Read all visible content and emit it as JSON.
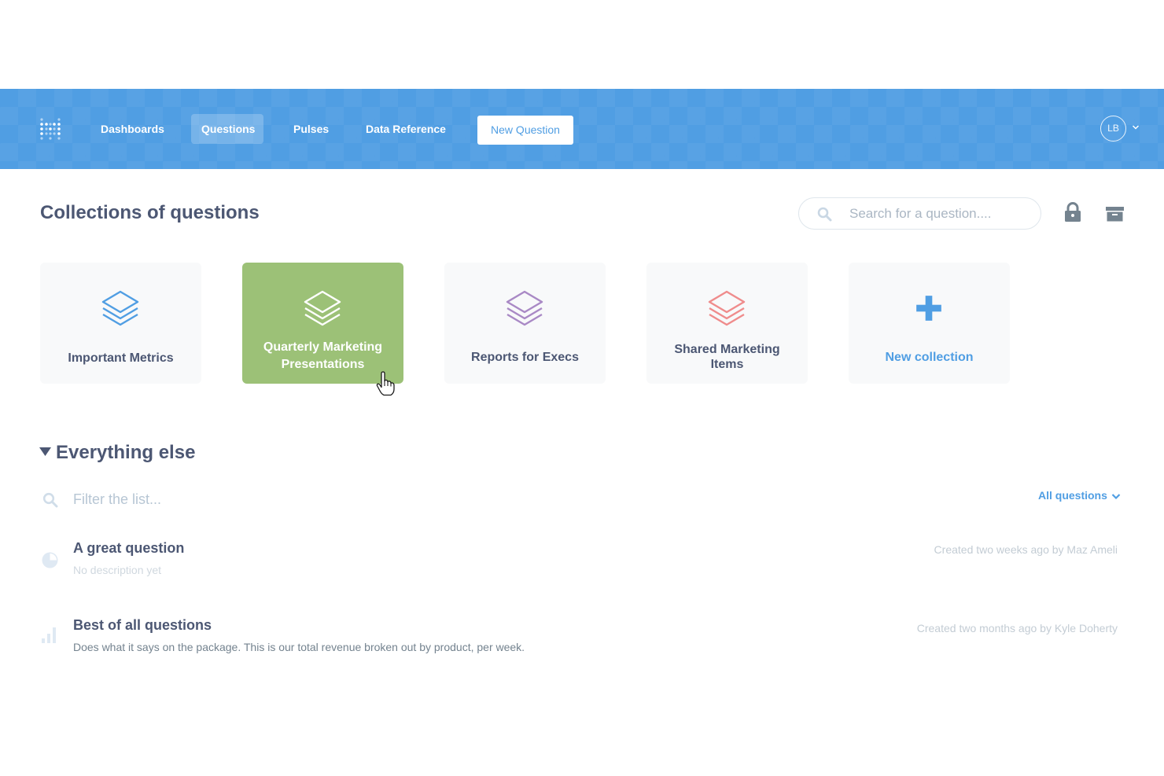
{
  "nav": {
    "logo_icon": "metabase-logo-icon",
    "links": [
      {
        "label": "Dashboards"
      },
      {
        "label": "Questions"
      },
      {
        "label": "Pulses"
      },
      {
        "label": "Data Reference"
      }
    ],
    "new_question_label": "New Question",
    "avatar_initials": "LB",
    "bar_color": "#509ee3"
  },
  "header": {
    "title": "Collections of questions",
    "search_placeholder": "Search for a question...."
  },
  "collections": [
    {
      "label": "Important Metrics",
      "icon": "stack-icon",
      "color": "#509ee3"
    },
    {
      "label_line1": "Quarterly Marketing",
      "label_line2": "Presentations",
      "icon": "stack-icon",
      "color": "#ffffff",
      "background": "#9cc177"
    },
    {
      "label": "Reports for Execs",
      "icon": "stack-icon",
      "color": "#a989c5"
    },
    {
      "label_line1": "Shared Marketing",
      "label_line2": "Items",
      "icon": "stack-icon",
      "color": "#ef8c8c"
    },
    {
      "label": "New collection",
      "icon": "plus-icon",
      "color": "#509ee3"
    }
  ],
  "everything_else": {
    "title": "Everything else",
    "filter_placeholder": "Filter the list...",
    "filter_dropdown": "All questions",
    "questions": [
      {
        "title": "A great question",
        "description": "No description yet",
        "meta": "Created two weeks ago by Maz Ameli",
        "icon": "pie-chart-icon"
      },
      {
        "title": "Best of all questions",
        "description": "Does what it says on the package. This is our total revenue broken out by product, per week.",
        "meta": "Created two months ago by Kyle Doherty",
        "icon": "bar-chart-icon"
      }
    ]
  }
}
